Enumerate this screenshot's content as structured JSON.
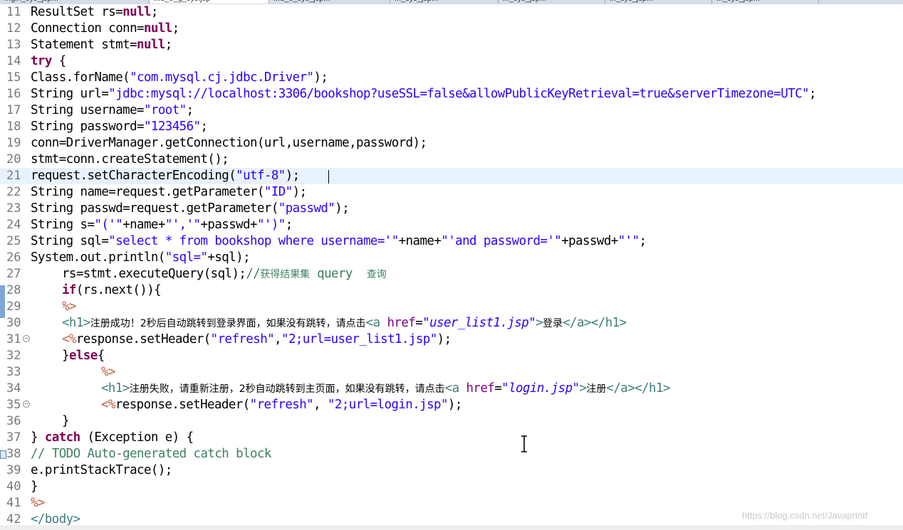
{
  "tabs": [
    "...gin_sys_jsp...",
    "...d_e_g_sys.jsp",
    "...d_e_sys_jsp...",
    "..._sys_jsp...",
    "..._sys_jsp...",
    "..._sys_jsp...",
    "..._sys_jsp..."
  ],
  "watermark": "https://blog.csdn.net/Javaprintf",
  "colors": {
    "keyword": "#7f0055",
    "string": "#2a00ff",
    "comment": "#3f7f5f",
    "tag": "#3f7f7f",
    "attribute": "#7f007f",
    "line_number": "#787878",
    "current_line": "#e8f2fe"
  },
  "lines": [
    {
      "n": "11",
      "indent": 0,
      "tokens": [
        [
          "",
          "ResultSet rs="
        ],
        [
          "kw",
          "null"
        ],
        [
          "",
          ";"
        ]
      ]
    },
    {
      "n": "12",
      "indent": 0,
      "tokens": [
        [
          "",
          "Connection conn="
        ],
        [
          "kw",
          "null"
        ],
        [
          "",
          ";"
        ]
      ]
    },
    {
      "n": "13",
      "indent": 0,
      "tokens": [
        [
          "",
          "Statement stmt="
        ],
        [
          "kw",
          "null"
        ],
        [
          "",
          ";"
        ]
      ]
    },
    {
      "n": "14",
      "indent": 0,
      "tokens": [
        [
          "kw",
          "try"
        ],
        [
          "",
          " {"
        ]
      ]
    },
    {
      "n": "15",
      "indent": 0,
      "tokens": [
        [
          "",
          "Class.forName("
        ],
        [
          "str",
          "\"com.mysql.cj.jdbc.Driver\""
        ],
        [
          "",
          ");"
        ]
      ]
    },
    {
      "n": "16",
      "indent": 0,
      "tokens": [
        [
          "",
          "String url="
        ],
        [
          "str",
          "\"jdbc:mysql://localhost:3306/bookshop?useSSL=false&allowPublicKeyRetrieval=true&serverTimezone=UTC\""
        ],
        [
          "",
          ";"
        ]
      ]
    },
    {
      "n": "17",
      "indent": 0,
      "tokens": [
        [
          "",
          "String username="
        ],
        [
          "str",
          "\"root\""
        ],
        [
          "",
          ";"
        ]
      ]
    },
    {
      "n": "18",
      "indent": 0,
      "tokens": [
        [
          "",
          "String password="
        ],
        [
          "str",
          "\"123456\""
        ],
        [
          "",
          ";"
        ]
      ]
    },
    {
      "n": "19",
      "indent": 0,
      "tokens": [
        [
          "",
          "conn=DriverManager.getConnection(url,username,password);"
        ]
      ]
    },
    {
      "n": "20",
      "indent": 0,
      "tokens": [
        [
          "",
          "stmt=conn.createStatement();"
        ]
      ]
    },
    {
      "n": "21",
      "indent": 0,
      "current": true,
      "tokens": [
        [
          "",
          "request.setCharacterEncoding("
        ],
        [
          "str",
          "\"utf-8\""
        ],
        [
          "",
          ");"
        ]
      ]
    },
    {
      "n": "22",
      "indent": 0,
      "tokens": [
        [
          "",
          "String name=request.getParameter("
        ],
        [
          "str",
          "\"ID\""
        ],
        [
          "",
          ");"
        ]
      ]
    },
    {
      "n": "23",
      "indent": 0,
      "tokens": [
        [
          "",
          "String passwd=request.getParameter("
        ],
        [
          "str",
          "\"passwd\""
        ],
        [
          "",
          ");"
        ]
      ]
    },
    {
      "n": "24",
      "indent": 0,
      "tokens": [
        [
          "",
          "String s="
        ],
        [
          "str",
          "\"('\""
        ],
        [
          "",
          "+name+"
        ],
        [
          "str",
          "\"','\""
        ],
        [
          "",
          "+passwd+"
        ],
        [
          "str",
          "\"')\""
        ],
        [
          "",
          ";"
        ]
      ]
    },
    {
      "n": "25",
      "indent": 0,
      "tokens": [
        [
          "",
          "String sql="
        ],
        [
          "str",
          "\"select * from bookshop where username='\""
        ],
        [
          "",
          "+name+"
        ],
        [
          "str",
          "\"'and password='\""
        ],
        [
          "",
          "+passwd+"
        ],
        [
          "str",
          "\"'\""
        ],
        [
          "",
          ";"
        ]
      ]
    },
    {
      "n": "26",
      "indent": 0,
      "tokens": [
        [
          "",
          "System.out.println("
        ],
        [
          "str",
          "\"sql=\""
        ],
        [
          "",
          "+sql);"
        ]
      ]
    },
    {
      "n": "27",
      "indent": 1,
      "tokens": [
        [
          "",
          "rs=stmt.executeQuery(sql);"
        ],
        [
          "cm",
          "//"
        ],
        [
          "cm cn",
          "获得结果集"
        ],
        [
          "cm",
          " query  "
        ],
        [
          "cm cn",
          "查询"
        ]
      ]
    },
    {
      "n": "28",
      "indent": 1,
      "tokens": [
        [
          "kw",
          "if"
        ],
        [
          "",
          "(rs.next()){"
        ]
      ]
    },
    {
      "n": "29",
      "indent": 1,
      "tokens": [
        [
          "jspd",
          "%>"
        ]
      ]
    },
    {
      "n": "30",
      "indent": 1,
      "tokens": [
        [
          "tag",
          "<h1>"
        ],
        [
          "cn",
          "注册成功！2秒后自动跳转到登录界面，如果没有跳转，请点击"
        ],
        [
          "tag",
          "<a "
        ],
        [
          "attr",
          "href"
        ],
        [
          "",
          "="
        ],
        [
          "val",
          "\"user_list1.jsp\""
        ],
        [
          "tag",
          ">"
        ],
        [
          "cn",
          "登录"
        ],
        [
          "tag",
          "</a></h1>"
        ]
      ]
    },
    {
      "n": "31",
      "indent": 1,
      "fold": true,
      "tokens": [
        [
          "jspd",
          "<%"
        ],
        [
          "",
          "response.setHeader("
        ],
        [
          "str",
          "\"refresh\""
        ],
        [
          "",
          ","
        ],
        [
          "str",
          "\"2;url=user_list1.jsp\""
        ],
        [
          "",
          ");"
        ]
      ]
    },
    {
      "n": "32",
      "indent": 1,
      "tokens": [
        [
          "",
          "}"
        ],
        [
          "kw",
          "else"
        ],
        [
          "",
          "{"
        ]
      ]
    },
    {
      "n": "33",
      "indent": 2,
      "tokens": [
        [
          "jspd",
          "%>"
        ]
      ]
    },
    {
      "n": "34",
      "indent": 2,
      "tokens": [
        [
          "tag",
          "<h1>"
        ],
        [
          "cn",
          "注册失败，请重新注册，2秒自动跳转到主页面，如果没有跳转，请点击"
        ],
        [
          "tag",
          "<a "
        ],
        [
          "attr",
          "href"
        ],
        [
          "",
          "="
        ],
        [
          "val",
          "\"login.jsp\""
        ],
        [
          "tag",
          ">"
        ],
        [
          "cn",
          "注册"
        ],
        [
          "tag",
          "</a></h1>"
        ]
      ]
    },
    {
      "n": "35",
      "indent": 2,
      "fold": true,
      "tokens": [
        [
          "jspd",
          "<%"
        ],
        [
          "",
          "response.setHeader("
        ],
        [
          "str",
          "\"refresh\""
        ],
        [
          "",
          ", "
        ],
        [
          "str",
          "\"2;url=login.jsp\""
        ],
        [
          "",
          ");"
        ]
      ]
    },
    {
      "n": "36",
      "indent": 1,
      "tokens": [
        [
          "",
          "}"
        ]
      ]
    },
    {
      "n": "37",
      "indent": 0,
      "tokens": [
        [
          "",
          "} "
        ],
        [
          "kw",
          "catch"
        ],
        [
          "",
          " (Exception e) {"
        ]
      ]
    },
    {
      "n": "38",
      "indent": 0,
      "annotation": true,
      "tokens": [
        [
          "cm",
          "// TODO Auto-generated catch block"
        ]
      ]
    },
    {
      "n": "39",
      "indent": 0,
      "tokens": [
        [
          "",
          "e.printStackTrace();"
        ]
      ]
    },
    {
      "n": "40",
      "indent": 0,
      "tokens": [
        [
          "",
          "}"
        ]
      ]
    },
    {
      "n": "41",
      "indent": 0,
      "tokens": [
        [
          "jspd",
          "%>"
        ]
      ]
    },
    {
      "n": "42",
      "indent": 0,
      "tokens": [
        [
          "tag",
          "</body>"
        ]
      ]
    }
  ]
}
